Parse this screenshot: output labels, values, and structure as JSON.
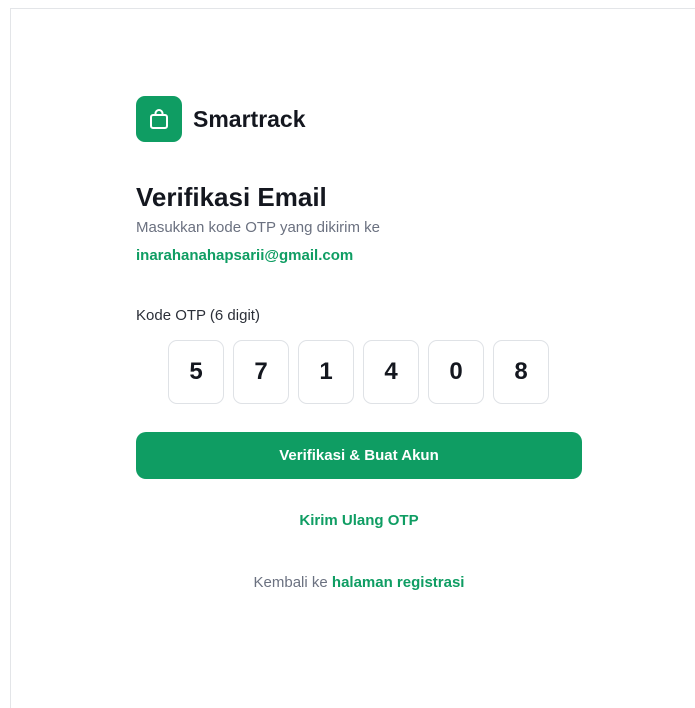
{
  "brand": {
    "name": "Smartrack",
    "logo_icon": "shopping-bag-icon",
    "color": "#0f9d63"
  },
  "page": {
    "title": "Verifikasi Email",
    "subtitle": "Masukkan kode OTP yang dikirim ke",
    "email": "inarahanahapsarii@gmail.com"
  },
  "otp": {
    "label": "Kode OTP (6 digit)",
    "digits": [
      "5",
      "7",
      "1",
      "4",
      "0",
      "8"
    ]
  },
  "actions": {
    "submit_label": "Verifikasi & Buat Akun",
    "resend_label": "Kirim Ulang OTP",
    "back_prefix": "Kembali ke",
    "back_link": "halaman registrasi"
  }
}
